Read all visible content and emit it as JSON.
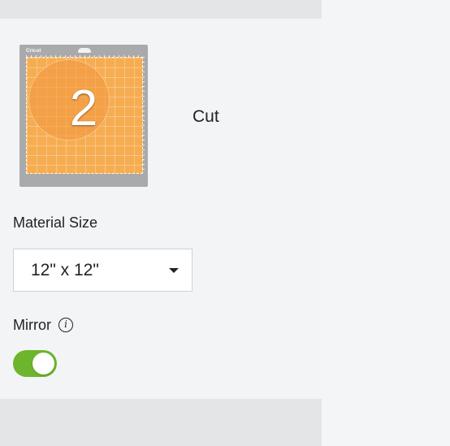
{
  "mat": {
    "brand": "Cricut",
    "mat_number": "2",
    "color": "#f6ad52"
  },
  "operation": {
    "label": "Cut"
  },
  "material_size": {
    "label": "Material Size",
    "selected_value": "12\" x 12\""
  },
  "mirror": {
    "label": "Mirror",
    "info_icon": "info-icon",
    "enabled": true,
    "toggle_color": "#6cb52d"
  }
}
